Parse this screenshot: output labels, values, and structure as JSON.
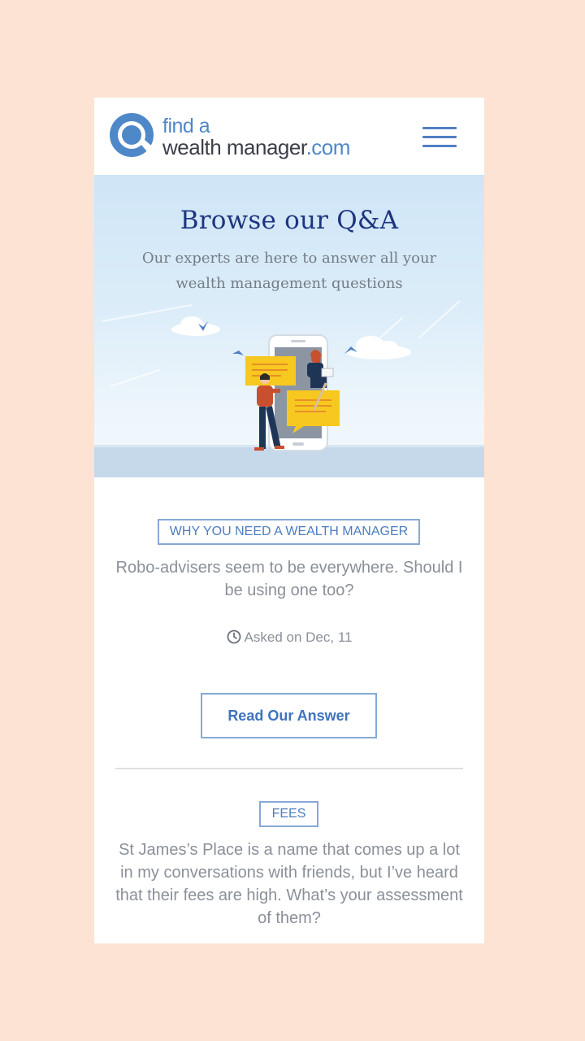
{
  "header": {
    "logo_line1": "find a",
    "logo_wealth": "wealth manager",
    "logo_com": ".com",
    "menu_icon": "hamburger-menu-icon"
  },
  "hero": {
    "title": "Browse our Q&A",
    "subtitle_line1": "Our experts are here to answer all your",
    "subtitle_line2": "wealth management questions"
  },
  "questions": [
    {
      "tag": "WHY YOU NEED A WEALTH MANAGER",
      "question": "Robo-advisers seem to be everywhere. Should I be using one too?",
      "asked": "Asked on Dec, 11",
      "button": "Read Our Answer"
    },
    {
      "tag": "FEES",
      "question": "St James’s Place is a name that comes up a lot in my conversations with friends, but I’ve heard that their fees are high. What’s your assessment of them?"
    }
  ],
  "colors": {
    "page_background": "#fde3d3",
    "brand_blue": "#4f88c8",
    "title_navy": "#1d3580",
    "tag_border": "#86a9d8"
  }
}
